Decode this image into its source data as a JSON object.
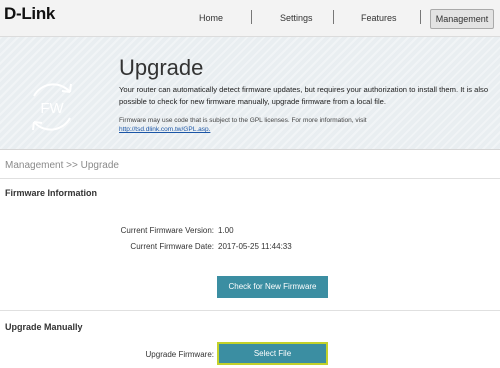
{
  "header": {
    "logo_text": "D-Link",
    "nav": [
      "Home",
      "Settings",
      "Features"
    ],
    "active_nav": "Management"
  },
  "banner": {
    "icon_label": "FW",
    "title": "Upgrade",
    "description": "Your router can automatically detect firmware updates, but requires your authorization to install them. It is also possible to check for new firmware manually, upgrade firmware from a local file.",
    "gpl_note": "Firmware may use code that is subject to the GPL licenses. For more information, visit",
    "gpl_link": "http://tsd.dlink.com.tw/GPL.asp."
  },
  "breadcrumb": "Management >> Upgrade",
  "firmware_info": {
    "heading": "Firmware Information",
    "version_label": "Current Firmware Version:",
    "version_value": "1.00",
    "date_label": "Current Firmware Date:",
    "date_value": "2017-05-25 11:44:33",
    "check_button": "Check for New Firmware"
  },
  "upgrade_manually": {
    "heading": "Upgrade Manually",
    "field_label": "Upgrade Firmware:",
    "select_button": "Select File"
  },
  "colors": {
    "button": "#3b8ea2",
    "focus_border": "#c2d12a",
    "link": "#1a55a6"
  }
}
